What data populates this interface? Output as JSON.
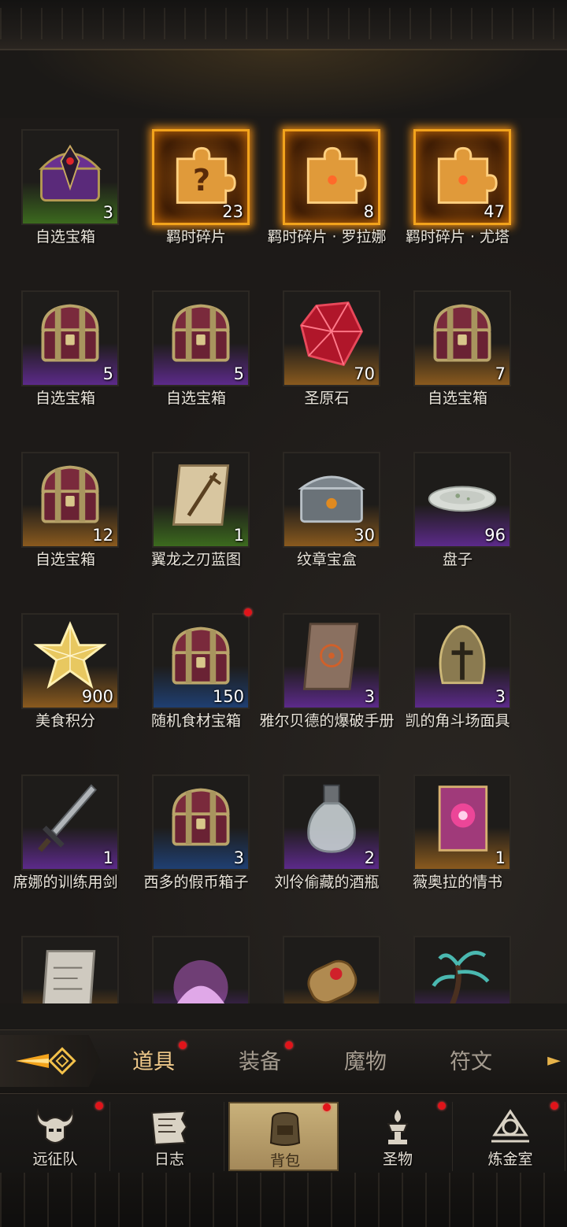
{
  "rarity_colors": {
    "green": "#3c6a1e",
    "purple": "#5c2a8a",
    "orange": "#8a5a1e",
    "blue": "#1f3f72",
    "gold": "#f2a31c"
  },
  "items": [
    {
      "name": "自选宝箱",
      "count": "3",
      "rarity": "green",
      "icon": "purple-crest-chest-icon",
      "red_dot": false
    },
    {
      "name": "羁时碎片",
      "count": "23",
      "rarity": "gold",
      "icon": "puzzle-question-icon",
      "red_dot": false
    },
    {
      "name": "羁时碎片 · 罗拉娜",
      "count": "8",
      "rarity": "gold",
      "icon": "puzzle-piece-icon",
      "red_dot": false
    },
    {
      "name": "羁时碎片 · 尤塔",
      "count": "47",
      "rarity": "gold",
      "icon": "puzzle-piece-icon",
      "red_dot": false
    },
    {
      "name": "自选宝箱",
      "count": "5",
      "rarity": "purple",
      "icon": "chest-icon",
      "red_dot": false
    },
    {
      "name": "自选宝箱",
      "count": "5",
      "rarity": "purple",
      "icon": "chest-icon",
      "red_dot": false
    },
    {
      "name": "圣原石",
      "count": "70",
      "rarity": "orange",
      "icon": "red-gem-icon",
      "red_dot": false
    },
    {
      "name": "自选宝箱",
      "count": "7",
      "rarity": "orange",
      "icon": "chest-icon",
      "red_dot": false
    },
    {
      "name": "自选宝箱",
      "count": "12",
      "rarity": "orange",
      "icon": "chest-icon",
      "red_dot": false
    },
    {
      "name": "翼龙之刃蓝图",
      "count": "1",
      "rarity": "green",
      "icon": "blueprint-scroll-icon",
      "red_dot": false
    },
    {
      "name": "纹章宝盒",
      "count": "30",
      "rarity": "orange",
      "icon": "ornate-box-icon",
      "red_dot": false
    },
    {
      "name": "盘子",
      "count": "96",
      "rarity": "purple",
      "icon": "plate-icon",
      "red_dot": false
    },
    {
      "name": "美食积分",
      "count": "900",
      "rarity": "orange",
      "icon": "star-crystal-icon",
      "red_dot": false
    },
    {
      "name": "随机食材宝箱",
      "count": "150",
      "rarity": "blue",
      "icon": "chest-icon",
      "red_dot": true
    },
    {
      "name": "雅尔贝德的爆破手册",
      "count": "3",
      "rarity": "purple",
      "icon": "manual-scroll-icon",
      "red_dot": false
    },
    {
      "name": "凯的角斗场面具",
      "count": "3",
      "rarity": "purple",
      "icon": "gladiator-helmet-icon",
      "red_dot": false
    },
    {
      "name": "席娜的训练用剑",
      "count": "1",
      "rarity": "purple",
      "icon": "sword-icon",
      "red_dot": false
    },
    {
      "name": "西多的假币箱子",
      "count": "3",
      "rarity": "blue",
      "icon": "chest-icon",
      "red_dot": false
    },
    {
      "name": "刘伶偷藏的酒瓶",
      "count": "2",
      "rarity": "purple",
      "icon": "flask-icon",
      "red_dot": false
    },
    {
      "name": "薇奥拉的情书",
      "count": "1",
      "rarity": "orange",
      "icon": "love-letter-scroll-icon",
      "red_dot": false
    },
    {
      "name": "",
      "count": "",
      "rarity": "orange",
      "icon": "paper-scroll-icon",
      "red_dot": false
    },
    {
      "name": "",
      "count": "",
      "rarity": "purple",
      "icon": "pink-powder-icon",
      "red_dot": false
    },
    {
      "name": "",
      "count": "",
      "rarity": "orange",
      "icon": "rolled-scroll-icon",
      "red_dot": false
    },
    {
      "name": "",
      "count": "",
      "rarity": "purple",
      "icon": "teal-plant-icon",
      "red_dot": false
    }
  ],
  "tabs": [
    {
      "label": "道具",
      "active": true,
      "red_dot": true
    },
    {
      "label": "装备",
      "active": false,
      "red_dot": true
    },
    {
      "label": "魔物",
      "active": false,
      "red_dot": false
    },
    {
      "label": "符文",
      "active": false,
      "red_dot": false
    }
  ],
  "nav": [
    {
      "label": "远征队",
      "icon": "horned-helmet-icon",
      "active": false,
      "red_dot": true
    },
    {
      "label": "日志",
      "icon": "journal-icon",
      "active": false,
      "red_dot": false
    },
    {
      "label": "背包",
      "icon": "backpack-icon",
      "active": true,
      "red_dot": true
    },
    {
      "label": "圣物",
      "icon": "relic-icon",
      "active": false,
      "red_dot": true
    },
    {
      "label": "炼金室",
      "icon": "alchemy-icon",
      "active": false,
      "red_dot": true
    }
  ]
}
